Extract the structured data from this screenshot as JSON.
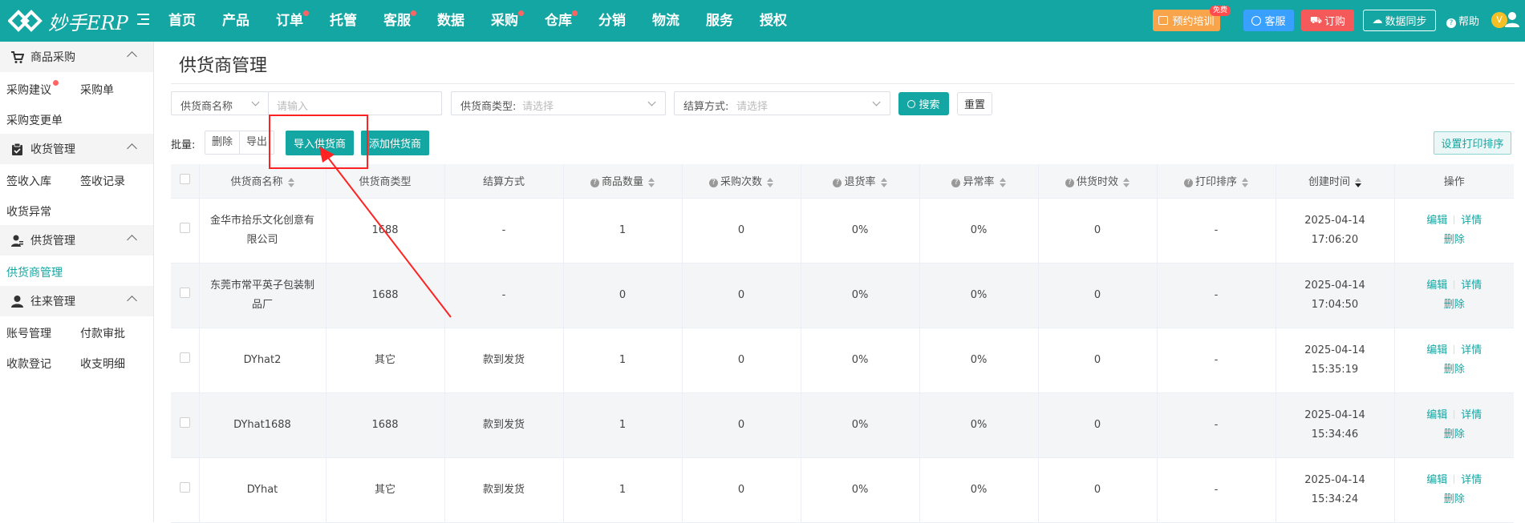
{
  "app": {
    "logo_text": "妙手ERP"
  },
  "nav": [
    {
      "label": "首页",
      "dot": false
    },
    {
      "label": "产品",
      "dot": false
    },
    {
      "label": "订单",
      "dot": true
    },
    {
      "label": "托管",
      "dot": false
    },
    {
      "label": "客服",
      "dot": true
    },
    {
      "label": "数据",
      "dot": false
    },
    {
      "label": "采购",
      "dot": true
    },
    {
      "label": "仓库",
      "dot": true
    },
    {
      "label": "分销",
      "dot": false
    },
    {
      "label": "物流",
      "dot": false
    },
    {
      "label": "服务",
      "dot": false
    },
    {
      "label": "授权",
      "dot": false
    }
  ],
  "topbar": {
    "training": "预约培训",
    "free_badge": "免费",
    "kefu": "客服",
    "order": "订购",
    "sync": "数据同步",
    "help": "帮助",
    "avatar": "V"
  },
  "sidebar": {
    "groups": [
      {
        "label": "商品采购",
        "icon": "cart-icon",
        "items": [
          {
            "label": "采购建议",
            "dot": true
          },
          {
            "label": "采购单",
            "dot": false
          },
          {
            "label": "采购变更单",
            "dot": false
          }
        ]
      },
      {
        "label": "收货管理",
        "icon": "clipboard-icon",
        "items": [
          {
            "label": "签收入库",
            "dot": false
          },
          {
            "label": "签收记录",
            "dot": false
          },
          {
            "label": "收货异常",
            "dot": false
          }
        ]
      },
      {
        "label": "供货管理",
        "icon": "supplier-icon",
        "items": [
          {
            "label": "供货商管理",
            "dot": false,
            "active": true
          }
        ]
      },
      {
        "label": "往来管理",
        "icon": "person-icon",
        "items": [
          {
            "label": "账号管理",
            "dot": false
          },
          {
            "label": "付款审批",
            "dot": false
          },
          {
            "label": "收款登记",
            "dot": false
          },
          {
            "label": "收支明细",
            "dot": false
          }
        ]
      }
    ]
  },
  "page": {
    "title": "供货商管理"
  },
  "filters": {
    "name_select": "供货商名称",
    "name_placeholder": "请输入",
    "type_label": "供货商类型:",
    "type_placeholder": "请选择",
    "settle_label": "结算方式:",
    "settle_placeholder": "请选择",
    "search": "搜索",
    "reset": "重置"
  },
  "toolbar": {
    "batch_label": "批量:",
    "delete": "删除",
    "export": "导出",
    "import": "导入供货商",
    "add": "添加供货商",
    "print_sort": "设置打印排序"
  },
  "table": {
    "headers": [
      "供货商名称",
      "供货商类型",
      "结算方式",
      "商品数量",
      "采购次数",
      "退货率",
      "异常率",
      "供货时效",
      "打印排序",
      "创建时间",
      "操作"
    ],
    "ops": {
      "edit": "编辑",
      "detail": "详情",
      "delete": "删除"
    },
    "rows": [
      {
        "name": "金华市拾乐文化创意有限公司",
        "type": "1688",
        "settle": "-",
        "goods": "1",
        "purchases": "0",
        "return_rate": "0%",
        "abnormal_rate": "0%",
        "lead_time": "0",
        "print_sort": "-",
        "date": "2025-04-14",
        "time": "17:06:20"
      },
      {
        "name": "东莞市常平英子包装制品厂",
        "type": "1688",
        "settle": "-",
        "goods": "0",
        "purchases": "0",
        "return_rate": "0%",
        "abnormal_rate": "0%",
        "lead_time": "0",
        "print_sort": "-",
        "date": "2025-04-14",
        "time": "17:04:50"
      },
      {
        "name": "DYhat2",
        "type": "其它",
        "settle": "款到发货",
        "goods": "1",
        "purchases": "0",
        "return_rate": "0%",
        "abnormal_rate": "0%",
        "lead_time": "0",
        "print_sort": "-",
        "date": "2025-04-14",
        "time": "15:35:19"
      },
      {
        "name": "DYhat1688",
        "type": "1688",
        "settle": "款到发货",
        "goods": "1",
        "purchases": "0",
        "return_rate": "0%",
        "abnormal_rate": "0%",
        "lead_time": "0",
        "print_sort": "-",
        "date": "2025-04-14",
        "time": "15:34:46"
      },
      {
        "name": "DYhat",
        "type": "其它",
        "settle": "款到发货",
        "goods": "1",
        "purchases": "0",
        "return_rate": "0%",
        "abnormal_rate": "0%",
        "lead_time": "0",
        "print_sort": "-",
        "date": "2025-04-14",
        "time": "15:34:24"
      }
    ]
  },
  "colors": {
    "brand": "#14a6a2",
    "annotation": "#ff2222"
  }
}
